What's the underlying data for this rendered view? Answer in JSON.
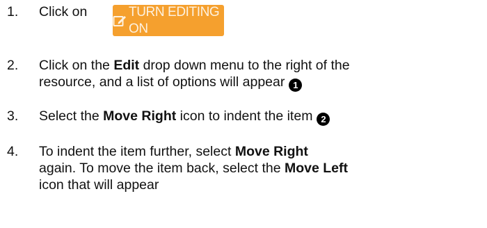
{
  "steps": [
    {
      "number": "1.",
      "prefix": "Click on "
    },
    {
      "number": "2.",
      "line1_pre": "Click on the ",
      "line1_bold": "Edit",
      "line1_post": " drop down menu to the right of the",
      "line2": "resource, and a list of options will appear",
      "badge": "1"
    },
    {
      "number": "3.",
      "pre": "Select the ",
      "bold": "Move Right",
      "post": " icon to indent the item",
      "badge": "2"
    },
    {
      "number": "4.",
      "line1_pre": "To indent the item further, select ",
      "line1_bold": "Move Right",
      "line2_pre": "again. To move the item back, select the ",
      "line2_bold": "Move Left",
      "line3": "icon that will appear"
    }
  ],
  "button": {
    "label": "TURN EDITING ON",
    "icon": "edit-icon",
    "color": "#f5a02e",
    "text_color": "#fdf1df"
  }
}
